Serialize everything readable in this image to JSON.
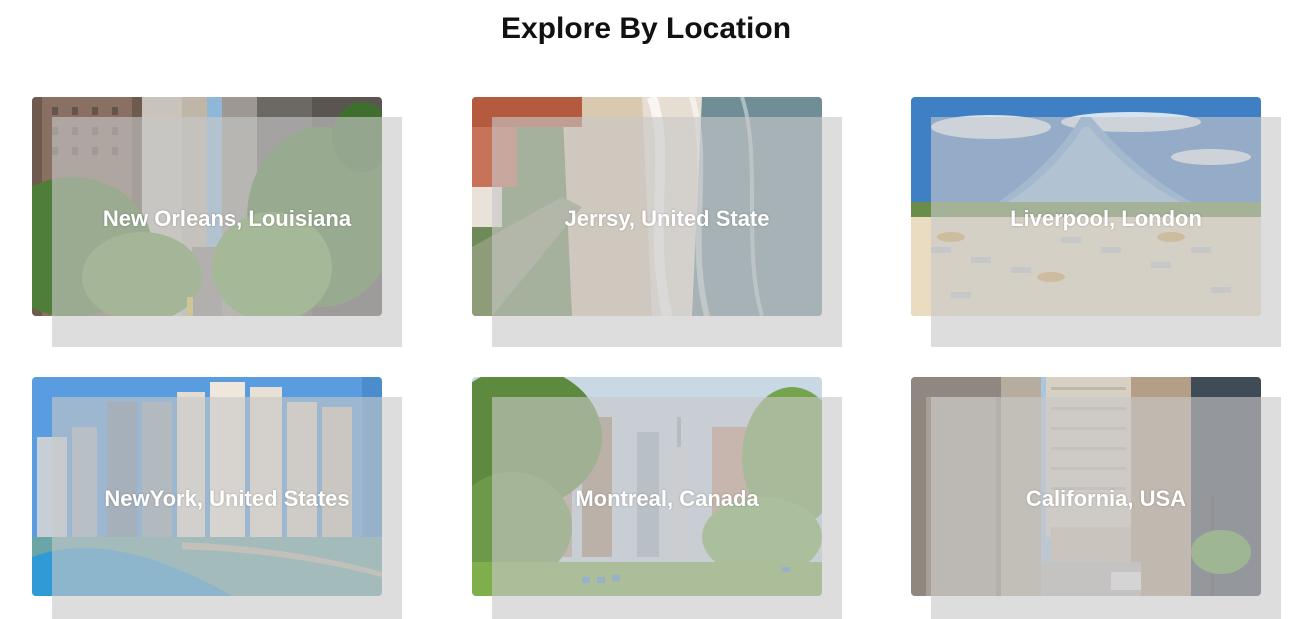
{
  "section": {
    "title": "Explore By Location"
  },
  "locations": [
    {
      "label": "New Orleans, Louisiana",
      "scene": "city-street-icon"
    },
    {
      "label": "Jerrsy, United State",
      "scene": "beach-aerial-icon"
    },
    {
      "label": "Liverpool, London",
      "scene": "resort-beach-icon"
    },
    {
      "label": "NewYork, United States",
      "scene": "marina-skyline-icon"
    },
    {
      "label": "Montreal, Canada",
      "scene": "park-skyline-icon"
    },
    {
      "label": "California, USA",
      "scene": "downtown-avenue-icon"
    }
  ]
}
